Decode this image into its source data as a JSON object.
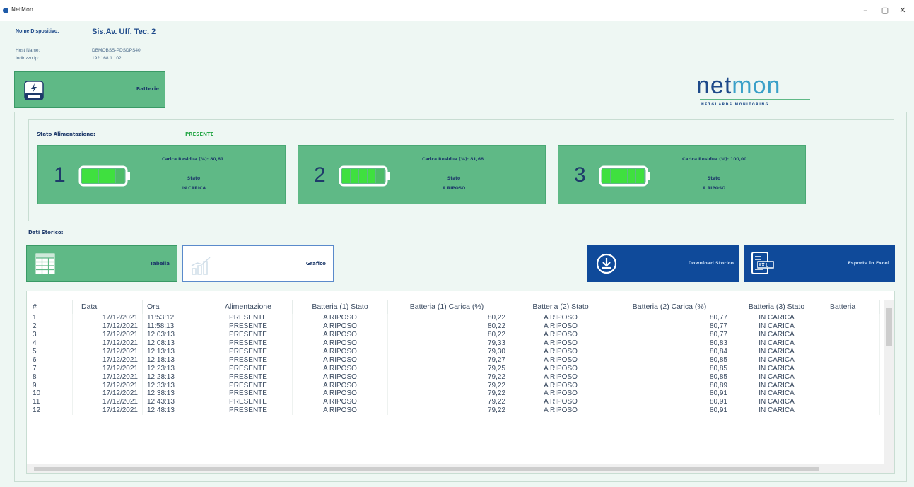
{
  "window": {
    "title": "NetMon",
    "minimize": "–",
    "maximize": "▢",
    "close": "✕"
  },
  "device": {
    "name_label": "Nome Dispositivo:",
    "name_value": "Sis.Av. Uff. Tec. 2",
    "host_label": "Host Name:",
    "host_value": "DBMOBSS-PDSDPS40",
    "ip_label": "Indirizzo Ip:",
    "ip_value": "192.168.1.102"
  },
  "nav": {
    "batterie_label": "Batterie"
  },
  "logo": {
    "text_a": "net",
    "text_b": "mon",
    "tagline": "NETGUARDS MONITORING"
  },
  "power": {
    "label": "Stato Alimentazione:",
    "value": "PRESENTE"
  },
  "batteries": [
    {
      "num": "1",
      "charge_label": "Carica Residua (%):",
      "charge_value": "80,61",
      "state_label": "Stato",
      "state_value": "IN CARICA",
      "level": 0.8
    },
    {
      "num": "2",
      "charge_label": "Carica Residua (%):",
      "charge_value": "81,68",
      "state_label": "Stato",
      "state_value": "A RIPOSO",
      "level": 0.82
    },
    {
      "num": "3",
      "charge_label": "Carica Residua (%):",
      "charge_value": "100,00",
      "state_label": "Stato",
      "state_value": "A RIPOSO",
      "level": 1.0
    }
  ],
  "history": {
    "label": "Dati Storico:",
    "tab_table": "Tabella",
    "tab_chart": "Grafico",
    "download": "Download Storico",
    "export": "Esporta in Excel"
  },
  "table": {
    "columns": [
      "#",
      "Data",
      "Ora",
      "Alimentazione",
      "Batteria (1) Stato",
      "Batteria (1) Carica (%)",
      "Batteria (2) Stato",
      "Batteria (2) Carica (%)",
      "Batteria (3) Stato",
      "Batteria"
    ],
    "rows": [
      [
        "1",
        "17/12/2021",
        "11:53:12",
        "PRESENTE",
        "A RIPOSO",
        "80,22",
        "A RIPOSO",
        "80,77",
        "IN CARICA",
        ""
      ],
      [
        "2",
        "17/12/2021",
        "11:58:13",
        "PRESENTE",
        "A RIPOSO",
        "80,22",
        "A RIPOSO",
        "80,77",
        "IN CARICA",
        ""
      ],
      [
        "3",
        "17/12/2021",
        "12:03:13",
        "PRESENTE",
        "A RIPOSO",
        "80,22",
        "A RIPOSO",
        "80,77",
        "IN CARICA",
        ""
      ],
      [
        "4",
        "17/12/2021",
        "12:08:13",
        "PRESENTE",
        "A RIPOSO",
        "79,33",
        "A RIPOSO",
        "80,83",
        "IN CARICA",
        ""
      ],
      [
        "5",
        "17/12/2021",
        "12:13:13",
        "PRESENTE",
        "A RIPOSO",
        "79,30",
        "A RIPOSO",
        "80,84",
        "IN CARICA",
        ""
      ],
      [
        "6",
        "17/12/2021",
        "12:18:13",
        "PRESENTE",
        "A RIPOSO",
        "79,27",
        "A RIPOSO",
        "80,85",
        "IN CARICA",
        ""
      ],
      [
        "7",
        "17/12/2021",
        "12:23:13",
        "PRESENTE",
        "A RIPOSO",
        "79,25",
        "A RIPOSO",
        "80,85",
        "IN CARICA",
        ""
      ],
      [
        "8",
        "17/12/2021",
        "12:28:13",
        "PRESENTE",
        "A RIPOSO",
        "79,22",
        "A RIPOSO",
        "80,85",
        "IN CARICA",
        ""
      ],
      [
        "9",
        "17/12/2021",
        "12:33:13",
        "PRESENTE",
        "A RIPOSO",
        "79,22",
        "A RIPOSO",
        "80,89",
        "IN CARICA",
        ""
      ],
      [
        "10",
        "17/12/2021",
        "12:38:13",
        "PRESENTE",
        "A RIPOSO",
        "79,22",
        "A RIPOSO",
        "80,91",
        "IN CARICA",
        ""
      ],
      [
        "11",
        "17/12/2021",
        "12:43:13",
        "PRESENTE",
        "A RIPOSO",
        "79,22",
        "A RIPOSO",
        "80,91",
        "IN CARICA",
        ""
      ],
      [
        "12",
        "17/12/2021",
        "12:48:13",
        "PRESENTE",
        "A RIPOSO",
        "79,22",
        "A RIPOSO",
        "80,91",
        "IN CARICA",
        ""
      ]
    ]
  },
  "colors": {
    "accent_green": "#5fb986",
    "brand_blue": "#0f4a9a",
    "battery_fill": "#3fe03f"
  }
}
